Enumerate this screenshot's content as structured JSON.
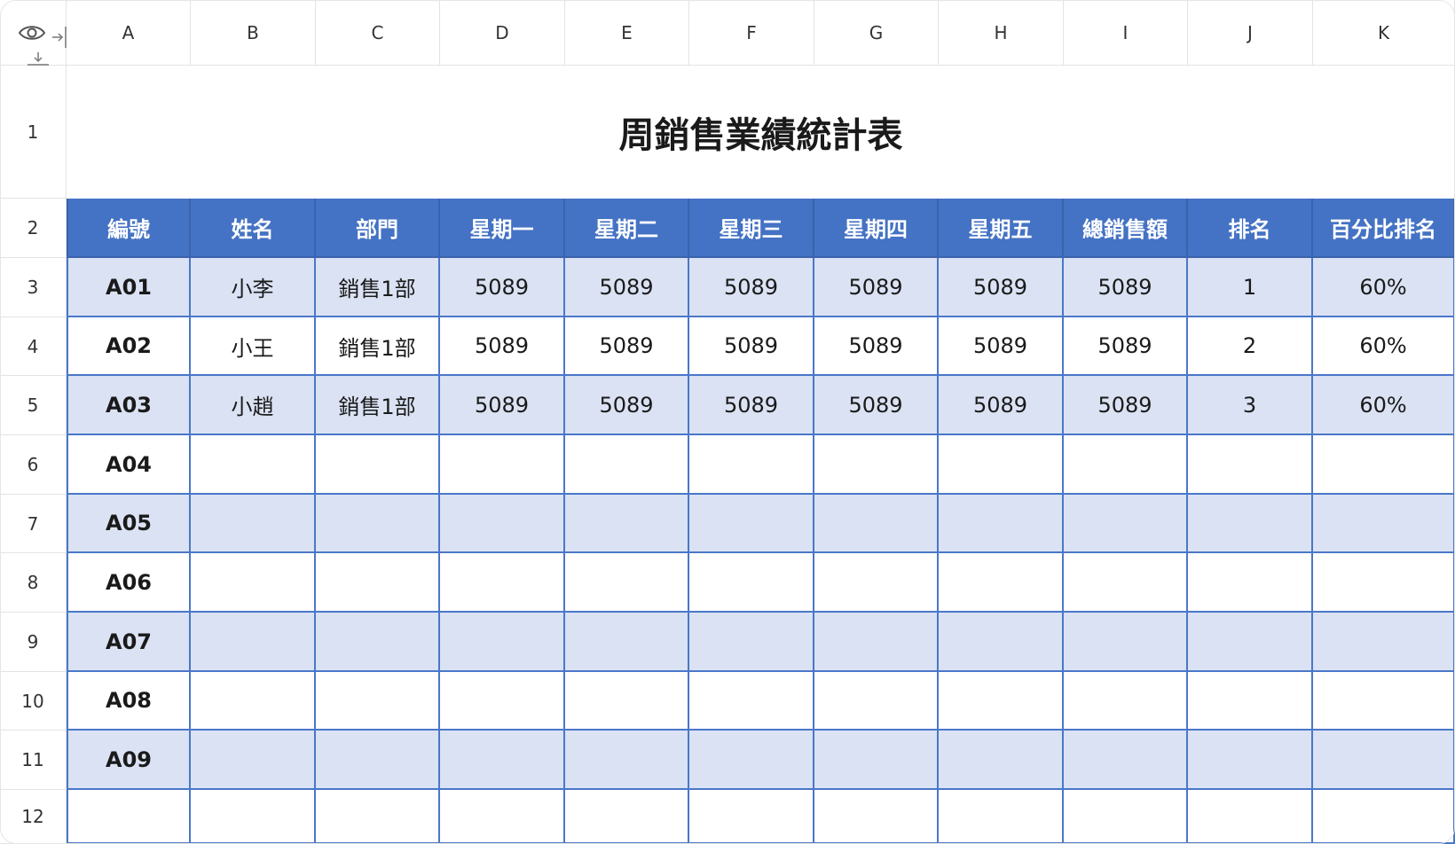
{
  "sheet": {
    "column_letters": [
      "A",
      "B",
      "C",
      "D",
      "E",
      "F",
      "G",
      "H",
      "I",
      "J",
      "K"
    ],
    "row_numbers": [
      "1",
      "2",
      "3",
      "4",
      "5",
      "6",
      "7",
      "8",
      "9",
      "10",
      "11",
      "12"
    ],
    "title": "周銷售業績統計表",
    "headers": [
      "編號",
      "姓名",
      "部門",
      "星期一",
      "星期二",
      "星期三",
      "星期四",
      "星期五",
      "總銷售額",
      "排名",
      "百分比排名"
    ],
    "rows": [
      [
        "A01",
        "小李",
        "銷售1部",
        "5089",
        "5089",
        "5089",
        "5089",
        "5089",
        "5089",
        "1",
        "60%"
      ],
      [
        "A02",
        "小王",
        "銷售1部",
        "5089",
        "5089",
        "5089",
        "5089",
        "5089",
        "5089",
        "2",
        "60%"
      ],
      [
        "A03",
        "小趙",
        "銷售1部",
        "5089",
        "5089",
        "5089",
        "5089",
        "5089",
        "5089",
        "3",
        "60%"
      ],
      [
        "A04",
        "",
        "",
        "",
        "",
        "",
        "",
        "",
        "",
        "",
        ""
      ],
      [
        "A05",
        "",
        "",
        "",
        "",
        "",
        "",
        "",
        "",
        "",
        ""
      ],
      [
        "A06",
        "",
        "",
        "",
        "",
        "",
        "",
        "",
        "",
        "",
        ""
      ],
      [
        "A07",
        "",
        "",
        "",
        "",
        "",
        "",
        "",
        "",
        "",
        ""
      ],
      [
        "A08",
        "",
        "",
        "",
        "",
        "",
        "",
        "",
        "",
        "",
        ""
      ],
      [
        "A09",
        "",
        "",
        "",
        "",
        "",
        "",
        "",
        "",
        "",
        ""
      ],
      [
        "",
        "",
        "",
        "",
        "",
        "",
        "",
        "",
        "",
        "",
        ""
      ]
    ]
  },
  "icons": {
    "toolbar": [
      "eye-icon",
      "collapse-columns-icon",
      "collapse-rows-icon"
    ]
  },
  "colors": {
    "header_fill": "#4472c4",
    "band_fill": "#dae2f3",
    "grid_line": "#4a77c9"
  }
}
